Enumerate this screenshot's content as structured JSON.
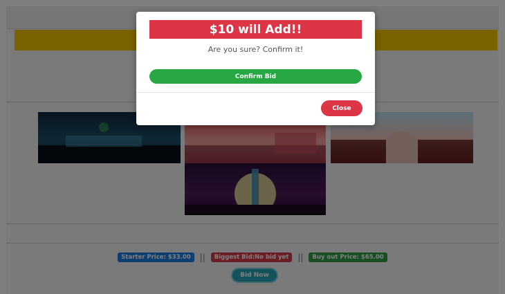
{
  "listing": {
    "starter_price": "Starter Price: $33.00",
    "separator": "||",
    "biggest_bid": "Biggest Bid:No bid yet",
    "buyout_price": "Buy out Price: $65.00",
    "bid_now_label": "Bid Now"
  },
  "modal": {
    "title": "$10 will Add!!",
    "message": "Are you sure? Confirm it!",
    "confirm_label": "Confirm Bid",
    "close_label": "Close"
  },
  "colors": {
    "banner": "#f5c400",
    "danger": "#dc3545",
    "success": "#28a745",
    "primary": "#1e7de0",
    "info": "#2aa6b8"
  }
}
